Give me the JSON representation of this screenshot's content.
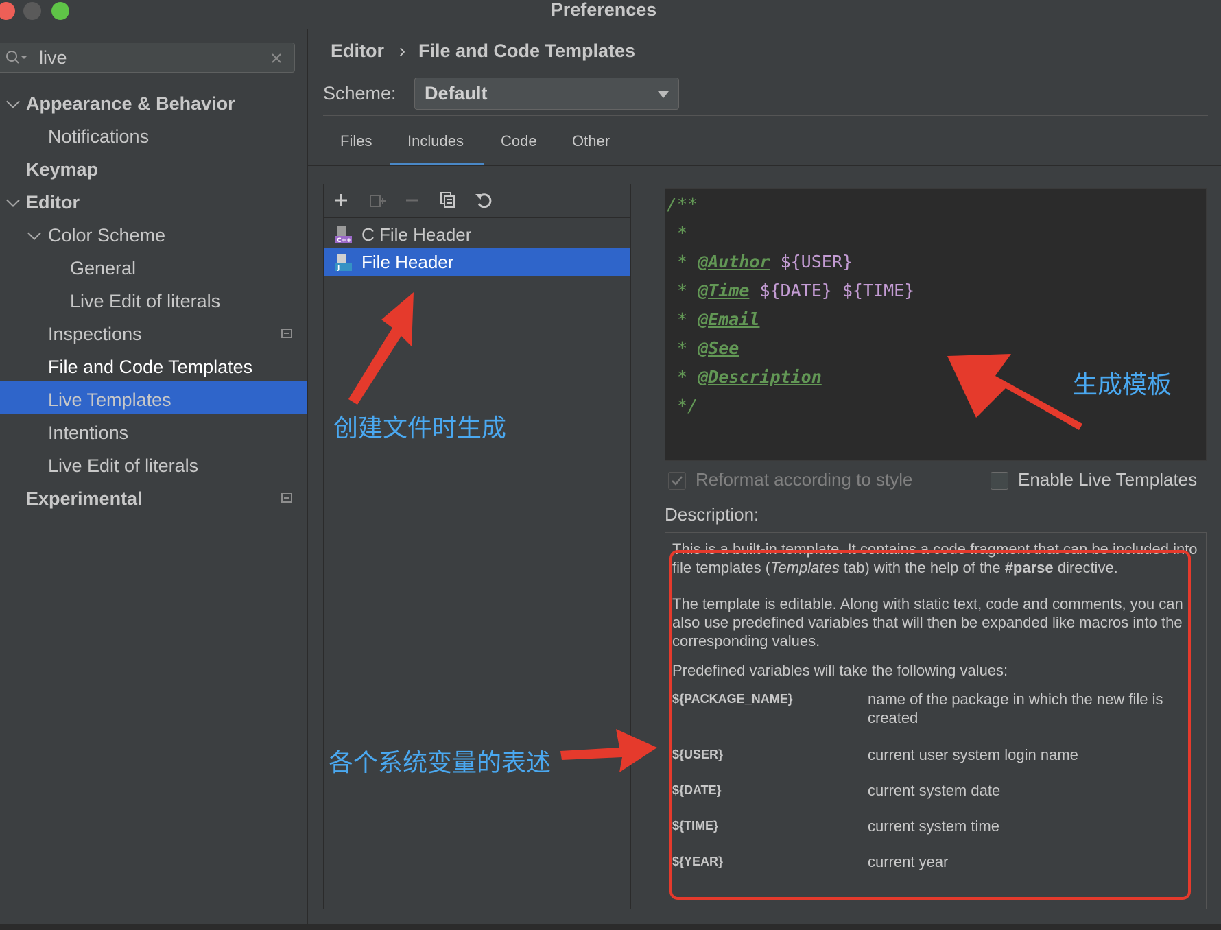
{
  "window": {
    "title": "Preferences"
  },
  "search": {
    "value": "live"
  },
  "sidebar": {
    "items": [
      {
        "label": "Appearance & Behavior"
      },
      {
        "label": "Notifications"
      },
      {
        "label": "Keymap"
      },
      {
        "label": "Editor"
      },
      {
        "label": "Color Scheme"
      },
      {
        "label": "General"
      },
      {
        "label": "Live Edit of literals"
      },
      {
        "label": "Inspections"
      },
      {
        "label": "File and Code Templates"
      },
      {
        "label": "Live Templates"
      },
      {
        "label": "Intentions"
      },
      {
        "label": "Live Edit of literals"
      },
      {
        "label": "Experimental"
      }
    ],
    "selected": "File and Code Templates"
  },
  "breadcrumb": {
    "parent": "Editor",
    "separator": "›",
    "current": "File and Code Templates"
  },
  "scheme": {
    "label": "Scheme:",
    "value": "Default"
  },
  "tabs": [
    {
      "label": "Files"
    },
    {
      "label": "Includes"
    },
    {
      "label": "Code"
    },
    {
      "label": "Other"
    }
  ],
  "active_tab": "Includes",
  "templates": [
    {
      "label": "C File Header",
      "icon": "c-file-icon"
    },
    {
      "label": "File Header",
      "icon": "java-file-icon"
    }
  ],
  "selected_template": "File Header",
  "code": {
    "line1": "/**",
    "line2": " *",
    "star": " * ",
    "author_tag": "@Author",
    "author_var": " ${USER}",
    "time_tag": "@Time",
    "time_var": " ${DATE} ${TIME}",
    "email_tag": "@Email",
    "see_tag": "@See",
    "desc_tag": "@Description",
    "end": " */"
  },
  "options": {
    "reformat": {
      "label": "Reformat according to style",
      "checked": true
    },
    "live_templates": {
      "label": "Enable Live Templates",
      "checked": false
    }
  },
  "description": {
    "label": "Description:",
    "p1a": "This is a built-in template. It contains a code fragment that can be included into file templates (",
    "p1_em": "Templates",
    "p1b": " tab) with the help of the ",
    "p1_strong": "#parse",
    "p1c": " directive.",
    "p2": "The template is editable. Along with static text, code and comments, you can also use predefined variables that will then be expanded like macros into the corresponding values.",
    "p3": "Predefined variables will take the following values:",
    "vars": [
      {
        "name": "${PACKAGE_NAME}",
        "desc": "name of the package in which the new file is created"
      },
      {
        "name": "${USER}",
        "desc": "current user system login name"
      },
      {
        "name": "${DATE}",
        "desc": "current system date"
      },
      {
        "name": "${TIME}",
        "desc": "current system time"
      },
      {
        "name": "${YEAR}",
        "desc": "current year"
      }
    ]
  },
  "annotations": {
    "created": "创建文件时生成",
    "template": "生成模板",
    "vars": "各个系统变量的表述"
  },
  "colors": {
    "accent": "#2f65ca",
    "annotation_arrow": "#e53a2c",
    "annotation_text": "#4aa8f0",
    "doc_comment": "#629755",
    "variable": "#c39bd3"
  }
}
